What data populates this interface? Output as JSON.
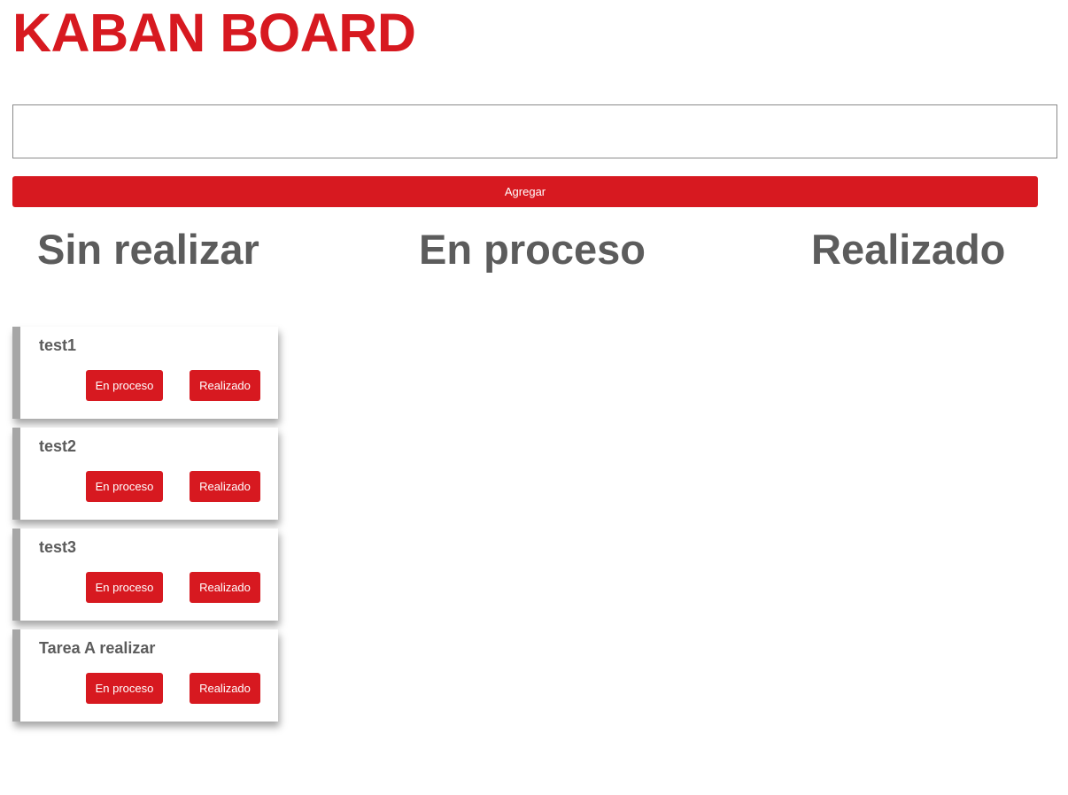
{
  "header": {
    "title": "KABAN BOARD"
  },
  "form": {
    "input_value": "",
    "input_placeholder": "",
    "add_label": "Agregar"
  },
  "columns": [
    {
      "label": "Sin realizar"
    },
    {
      "label": "En proceso"
    },
    {
      "label": "Realizado"
    }
  ],
  "tasks": [
    {
      "title": "test1",
      "btn_process": "En proceso",
      "btn_done": "Realizado"
    },
    {
      "title": "test2",
      "btn_process": "En proceso",
      "btn_done": "Realizado"
    },
    {
      "title": "test3",
      "btn_process": "En proceso",
      "btn_done": "Realizado"
    },
    {
      "title": "Tarea A realizar",
      "btn_process": "En proceso",
      "btn_done": "Realizado"
    }
  ],
  "colors": {
    "accent": "#d71920",
    "text": "#5c5c5c",
    "card_border": "#a6a6a6"
  }
}
